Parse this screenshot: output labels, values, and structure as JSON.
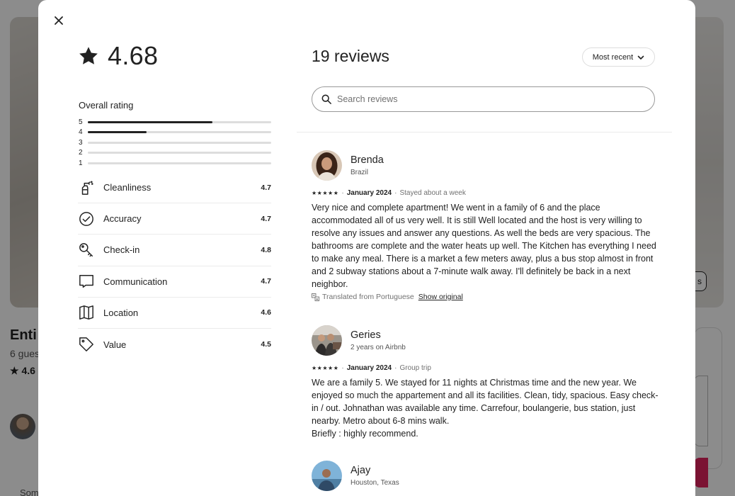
{
  "background": {
    "title_fragment": "Enti",
    "subtitle_fragment": "6 gues",
    "rating_fragment": "4.6",
    "more_fragment": "Som",
    "pill_fragment": "s"
  },
  "modal": {
    "overall_score": "4.68",
    "overall_label": "Overall rating",
    "distribution": [
      {
        "stars": "5",
        "fraction": 0.68
      },
      {
        "stars": "4",
        "fraction": 0.32
      },
      {
        "stars": "3",
        "fraction": 0
      },
      {
        "stars": "2",
        "fraction": 0
      },
      {
        "stars": "1",
        "fraction": 0
      }
    ],
    "categories": [
      {
        "label": "Cleanliness",
        "value": "4.7",
        "icon": "spray-bottle-icon"
      },
      {
        "label": "Accuracy",
        "value": "4.7",
        "icon": "check-circle-icon"
      },
      {
        "label": "Check-in",
        "value": "4.8",
        "icon": "key-icon"
      },
      {
        "label": "Communication",
        "value": "4.7",
        "icon": "chat-bubble-icon"
      },
      {
        "label": "Location",
        "value": "4.6",
        "icon": "map-icon"
      },
      {
        "label": "Value",
        "value": "4.5",
        "icon": "tag-icon"
      }
    ],
    "reviews_title": "19 reviews",
    "sort_label": "Most recent",
    "search_placeholder": "Search reviews",
    "reviews": [
      {
        "name": "Brenda",
        "sub": "Brazil",
        "stars": "★★★★★",
        "date": "January 2024",
        "stay": "Stayed about a week",
        "text": "Very nice and complete apartment! We went in a family of 6 and the place accommodated all of us very well. It is still Well located and the host is very willing to resolve any issues and answer any questions. As well the beds are very spacious. The bathrooms are complete and the water heats up well. The Kitchen has everything I need to make any meal. There is a market a few meters away, plus a bus stop almost in front and 2 subway stations about a 7-minute walk away. I'll definitely be back in a next neighbor.",
        "translated": "Translated from Portuguese",
        "show_original": "Show original"
      },
      {
        "name": "Geries",
        "sub": "2 years on Airbnb",
        "stars": "★★★★★",
        "date": "January 2024",
        "stay": "Group trip",
        "text": "We are a family 5. We stayed for 11 nights at Christmas time and the new year. We enjoyed so much the appartement and all its facilities. Clean, tidy, spacious. Easy check-in / out. Johnathan was available any time. Carrefour, boulangerie, bus station, just nearby. Metro about 6-8 mins walk.\nBriefly : highly recommend."
      },
      {
        "name": "Ajay",
        "sub": "Houston, Texas"
      }
    ]
  }
}
